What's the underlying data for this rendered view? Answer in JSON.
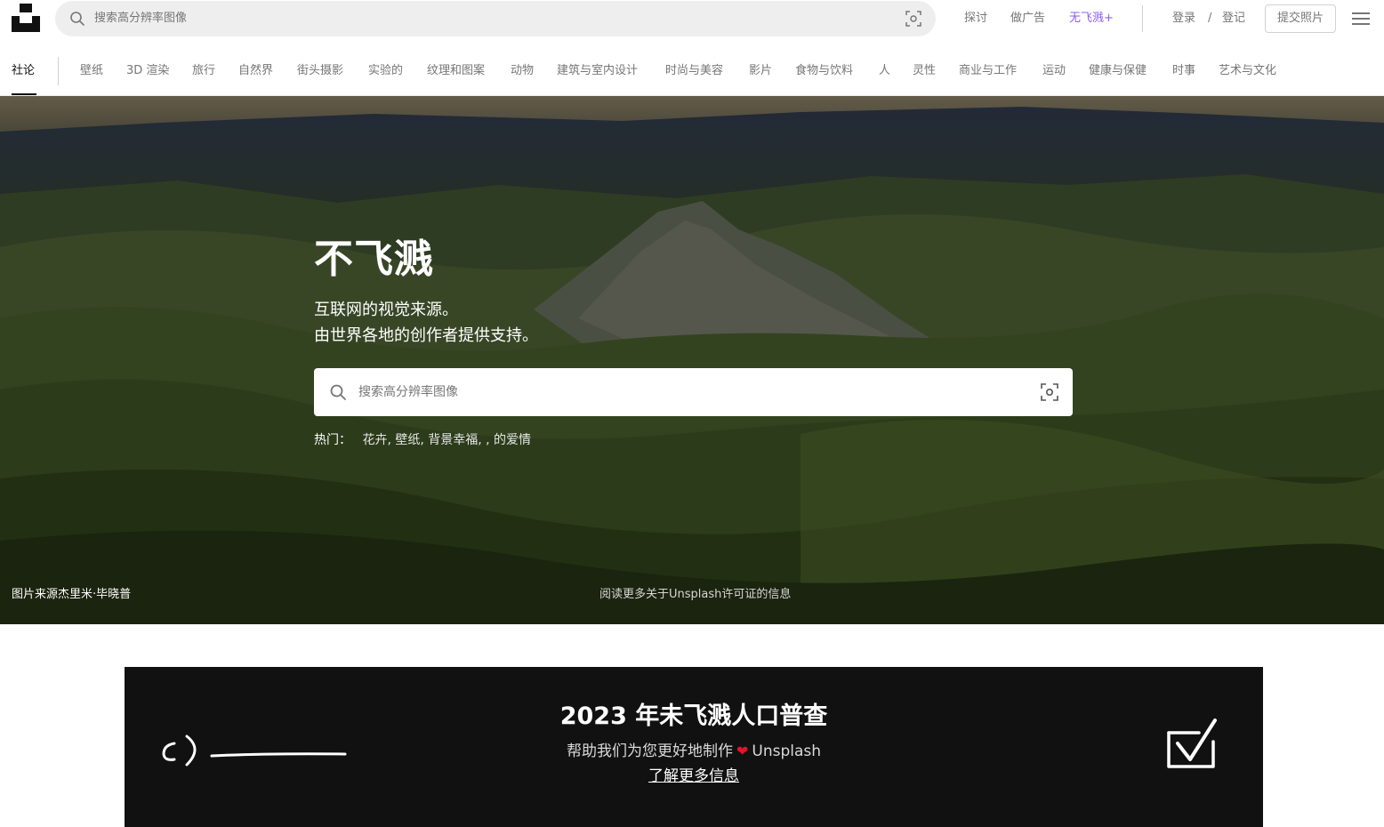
{
  "header": {
    "search_placeholder": "搜索高分辨率图像",
    "nav": {
      "explore": "探讨",
      "advertise": "做广告",
      "plus": "无飞溅+",
      "login": "登录",
      "separator": "/",
      "signup": "登记",
      "submit_photo": "提交照片"
    },
    "plus_color": "#8b5cf6"
  },
  "topics": {
    "active": "社论",
    "items": [
      "壁纸",
      "3D 渲染",
      "旅行",
      "自然界",
      "街头摄影",
      "实验的",
      "纹理和图案",
      "动物",
      "建筑与室内设计",
      "时尚与美容",
      "影片",
      "食物与饮料",
      "人",
      "灵性",
      "商业与工作",
      "运动",
      "健康与保健",
      "时事",
      "艺术与文化"
    ]
  },
  "hero": {
    "title": "不飞溅",
    "subtitle_line1": "互联网的视觉来源。",
    "subtitle_line2": "由世界各地的创作者提供支持。",
    "search_placeholder": "搜索高分辨率图像",
    "trending_label": "热门：",
    "trending_items": "花卉, 壁纸, 背景幸福, , 的爱情",
    "photo_credit": "图片来源杰里米·毕晓普",
    "license_note": "阅读更多关于Unsplash许可证的信息"
  },
  "banner": {
    "title": "2023 年未飞溅人口普查",
    "subtitle_before": "帮助我们为您更好地制作",
    "subtitle_after": "Unsplash",
    "heart": "❤",
    "link": "了解更多信息",
    "background": "#111111"
  }
}
